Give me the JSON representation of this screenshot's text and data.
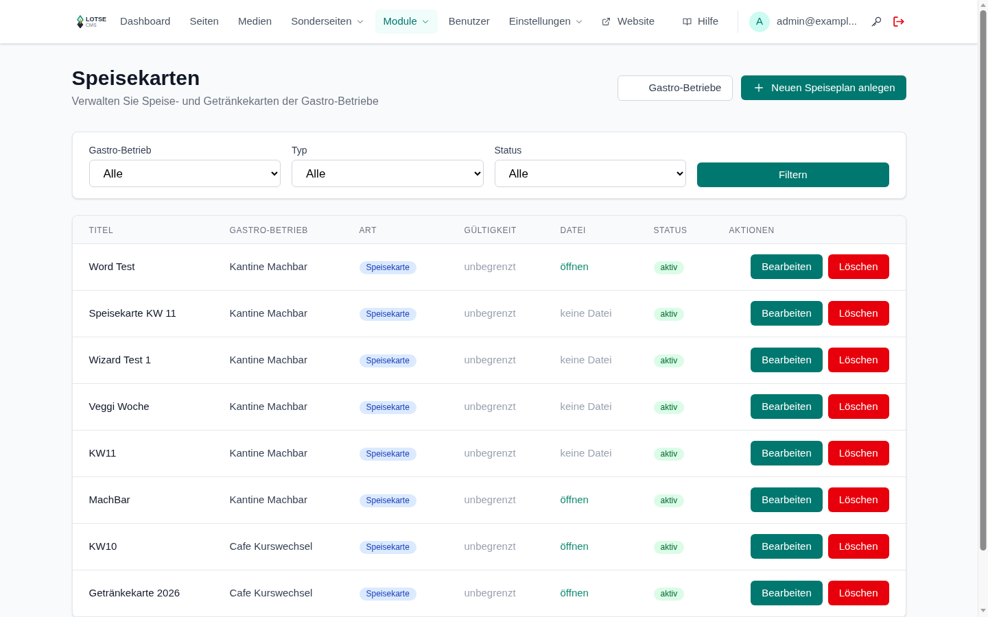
{
  "nav": {
    "logo": {
      "name": "LOTSE",
      "sub": "CMS"
    },
    "items": [
      {
        "label": "Dashboard",
        "selected": false,
        "dropdown": false
      },
      {
        "label": "Seiten",
        "selected": false,
        "dropdown": false
      },
      {
        "label": "Medien",
        "selected": false,
        "dropdown": false
      },
      {
        "label": "Sonderseiten",
        "selected": false,
        "dropdown": true
      },
      {
        "label": "Module",
        "selected": true,
        "dropdown": true
      },
      {
        "label": "Benutzer",
        "selected": false,
        "dropdown": false
      },
      {
        "label": "Einstellungen",
        "selected": false,
        "dropdown": true
      }
    ],
    "links": [
      {
        "label": "Website",
        "kind": "external"
      },
      {
        "label": "Hilfe",
        "kind": "help"
      }
    ],
    "user": {
      "initial": "A",
      "email": "admin@exampl..."
    }
  },
  "header": {
    "title": "Speisekarten",
    "subtitle": "Verwalten Sie Speise- und Getränkekarten der Gastro-Betriebe",
    "buttons": [
      {
        "label": "Gastro-Betriebe",
        "kind": "secondary"
      },
      {
        "label": "Neuen Speiseplan anlegen",
        "kind": "primary"
      }
    ]
  },
  "filters": {
    "fields": [
      {
        "label": "Gastro-Betrieb",
        "value": "Alle"
      },
      {
        "label": "Typ",
        "value": "Alle"
      },
      {
        "label": "Status",
        "value": "Alle"
      }
    ],
    "button": "Filtern"
  },
  "table": {
    "columns": [
      "TITEL",
      "GASTRO-BETRIEB",
      "ART",
      "GÜLTIGKEIT",
      "DATEI",
      "STATUS",
      "AKTIONEN"
    ],
    "rows": [
      {
        "title": "Word Test",
        "venue": "Kantine Machbar",
        "type": "Speisekarte",
        "validity": "unbegrenzt",
        "file": {
          "kind": "link",
          "text": "öffnen"
        },
        "status": "aktiv",
        "actions": [
          {
            "label": "Bearbeiten",
            "kind": "edit"
          },
          {
            "label": "Löschen",
            "kind": "delete"
          }
        ]
      },
      {
        "title": "Speisekarte KW 11",
        "venue": "Kantine Machbar",
        "type": "Speisekarte",
        "validity": "unbegrenzt",
        "file": {
          "kind": "none",
          "text": "keine Datei"
        },
        "status": "aktiv",
        "actions": [
          {
            "label": "Bearbeiten",
            "kind": "edit"
          },
          {
            "label": "Löschen",
            "kind": "delete"
          }
        ]
      },
      {
        "title": "Wizard Test 1",
        "venue": "Kantine Machbar",
        "type": "Speisekarte",
        "validity": "unbegrenzt",
        "file": {
          "kind": "none",
          "text": "keine Datei"
        },
        "status": "aktiv",
        "actions": [
          {
            "label": "Bearbeiten",
            "kind": "edit"
          },
          {
            "label": "Löschen",
            "kind": "delete"
          }
        ]
      },
      {
        "title": "Veggi Woche",
        "venue": "Kantine Machbar",
        "type": "Speisekarte",
        "validity": "unbegrenzt",
        "file": {
          "kind": "none",
          "text": "keine Datei"
        },
        "status": "aktiv",
        "actions": [
          {
            "label": "Bearbeiten",
            "kind": "edit"
          },
          {
            "label": "Löschen",
            "kind": "delete"
          }
        ]
      },
      {
        "title": "KW11",
        "venue": "Kantine Machbar",
        "type": "Speisekarte",
        "validity": "unbegrenzt",
        "file": {
          "kind": "none",
          "text": "keine Datei"
        },
        "status": "aktiv",
        "actions": [
          {
            "label": "Bearbeiten",
            "kind": "edit"
          },
          {
            "label": "Löschen",
            "kind": "delete"
          }
        ]
      },
      {
        "title": "MachBar",
        "venue": "Kantine Machbar",
        "type": "Speisekarte",
        "validity": "unbegrenzt",
        "file": {
          "kind": "link",
          "text": "öffnen"
        },
        "status": "aktiv",
        "actions": [
          {
            "label": "Bearbeiten",
            "kind": "edit"
          },
          {
            "label": "Löschen",
            "kind": "delete"
          }
        ]
      },
      {
        "title": "KW10",
        "venue": "Cafe Kurswechsel",
        "type": "Speisekarte",
        "validity": "unbegrenzt",
        "file": {
          "kind": "link",
          "text": "öffnen"
        },
        "status": "aktiv",
        "actions": [
          {
            "label": "Bearbeiten",
            "kind": "edit"
          },
          {
            "label": "Löschen",
            "kind": "delete"
          }
        ]
      },
      {
        "title": "Getränkekarte 2026",
        "venue": "Cafe Kurswechsel",
        "type": "Speisekarte",
        "validity": "unbegrenzt",
        "file": {
          "kind": "link",
          "text": "öffnen"
        },
        "status": "aktiv",
        "actions": [
          {
            "label": "Bearbeiten",
            "kind": "edit"
          },
          {
            "label": "Löschen",
            "kind": "delete"
          }
        ]
      }
    ]
  }
}
